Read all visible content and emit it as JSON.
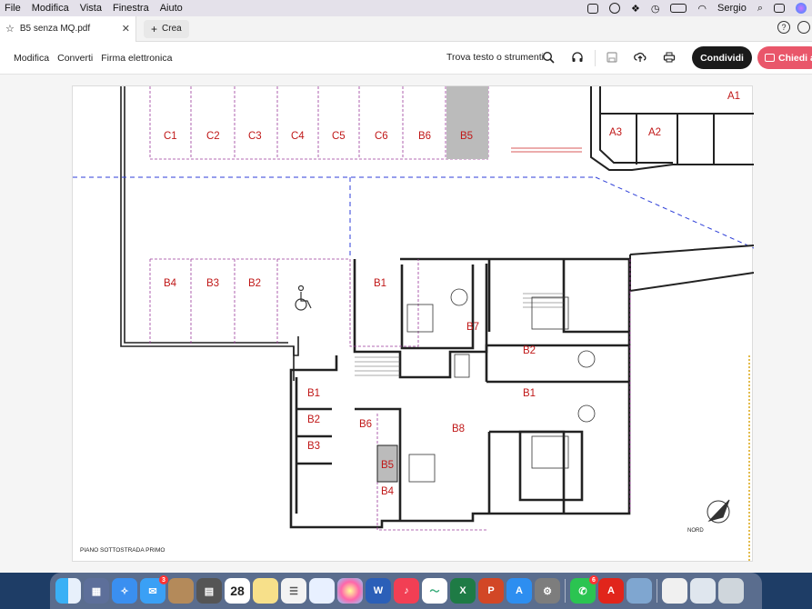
{
  "menubar": {
    "items": [
      "File",
      "Modifica",
      "Vista",
      "Finestra",
      "Aiuto"
    ],
    "user": "Sergio"
  },
  "tabs": {
    "doc_title": "B5 senza MQ.pdf",
    "new_label": "Crea"
  },
  "toolbar": {
    "modifica": "Modifica",
    "converti": "Converti",
    "firma": "Firma elettronica",
    "find": "Trova testo o strumenti",
    "share": "Condividi",
    "ask": "Chiedi a"
  },
  "plan": {
    "caption": "PIANO SOTTOSTRADA PRIMO",
    "north": "NORD",
    "top_spaces": [
      "C1",
      "C2",
      "C3",
      "C4",
      "C5",
      "C6",
      "B6",
      "B5"
    ],
    "mid_spaces": [
      "B4",
      "B3",
      "B2",
      "B1"
    ],
    "right_units": [
      "A3",
      "A2",
      "A1"
    ],
    "apartment_labels": [
      "B7",
      "B2",
      "B1",
      "B8",
      "B6",
      "B5",
      "B4"
    ],
    "cellars": [
      "B1",
      "B2",
      "B3"
    ]
  },
  "dock": {
    "calendar_day": "28",
    "badges": {
      "mail": "3",
      "whatsapp": "6"
    },
    "apps": [
      "finder",
      "launchpad",
      "safari",
      "mail",
      "photos-folder",
      "calculator",
      "calendar",
      "notes",
      "reminders",
      "photos",
      "word",
      "music",
      "freeform",
      "excel",
      "powerpoint",
      "app-store",
      "settings",
      "whatsapp",
      "acrobat",
      "preview",
      "documents",
      "downloads",
      "trash"
    ]
  }
}
